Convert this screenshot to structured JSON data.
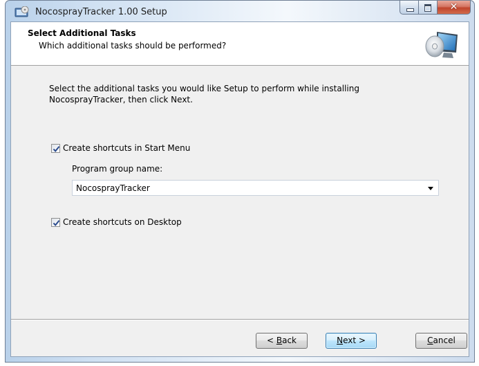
{
  "window": {
    "title": "NocosprayTracker 1.00 Setup",
    "app_icon": "installer-icon",
    "caption_buttons": {
      "minimize": "minimize-icon",
      "maximize": "maximize-icon",
      "close": "close-icon"
    }
  },
  "header": {
    "title": "Select Additional Tasks",
    "subtitle": "Which additional tasks should be performed?",
    "icon": "install-disc-icon"
  },
  "body": {
    "intro_line1": "Select the additional tasks you would like Setup to perform while installing",
    "intro_line2": "NocosprayTracker, then click Next.",
    "tasks": [
      {
        "label": "Create shortcuts in Start Menu",
        "checked": true
      },
      {
        "label": "Create shortcuts on Desktop",
        "checked": true
      }
    ],
    "group_name_label": "Program group name:",
    "group_name_value": "NocosprayTracker"
  },
  "buttons": {
    "back_pre": "< ",
    "back_accel": "B",
    "back_post": "ack",
    "next_accel": "N",
    "next_post": "ext >",
    "cancel_accel": "C",
    "cancel_post": "ancel"
  },
  "colors": {
    "titlebar_accent": "#b9d1ea",
    "default_button_border": "#3c7fb1",
    "close_button": "#c0452d"
  }
}
